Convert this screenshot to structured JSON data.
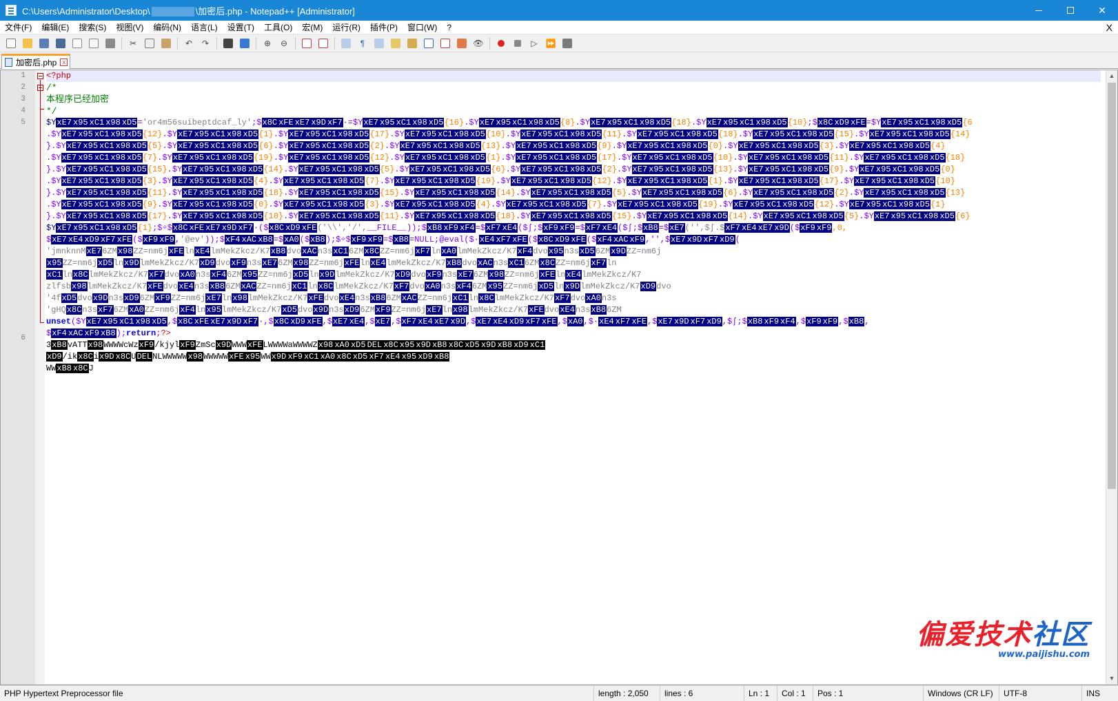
{
  "window": {
    "title_prefix": "C:\\Users\\Administrator\\Desktop\\",
    "title_suffix": "\\加密后.php - Notepad++ [Administrator]",
    "minimize": "—",
    "maximize": "☐",
    "close": "✕"
  },
  "menu": {
    "items": [
      "文件(F)",
      "编辑(E)",
      "搜索(S)",
      "视图(V)",
      "编码(N)",
      "语言(L)",
      "设置(T)",
      "工具(O)",
      "宏(M)",
      "运行(R)",
      "插件(P)",
      "窗口(W)",
      "?"
    ],
    "close_glyph": "X"
  },
  "tab": {
    "label": "加密后.php",
    "close": "x"
  },
  "editor": {
    "line_numbers": [
      "1",
      "2",
      "3",
      "4",
      "5",
      "6"
    ],
    "line1": "<?php",
    "line2": "/*",
    "line3": "本程序已经加密",
    "line4": "*/",
    "line5_start": "$Y",
    "line5_string": "'or4m56suibeptdcaf_ly'",
    "hex_tokens": [
      "xE7",
      "x95",
      "xC1",
      "x98",
      "xD5",
      "x8C",
      "xFE",
      "x9D",
      "xF7",
      "xE4",
      "xD9",
      "xA0",
      "xB8",
      "xF9",
      "xF4",
      "xAC"
    ],
    "func_file": "__FILE__",
    "at_ev": "'@ev'",
    "eval": "@eval",
    "null": "NULL",
    "unset": "unset",
    "return": "return",
    "close_tag": "?>",
    "b64_a": "'jmnknnM",
    "b64_b": "6ZM",
    "b64_c": "ZZ=nm6j",
    "b64_d": "ln",
    "b64_e": "lmMekZkcz/K7",
    "b64_f": "'4f",
    "b64_g": "dvo",
    "b64_h": "'gHQ",
    "b64_i": "zlfsb",
    "b64_j": "n3s",
    "line6_start": "3",
    "line6_a": "vATT",
    "line6_b": "WWWWcWz",
    "line6_c": "/kjyl",
    "line6_d": "ZmSc",
    "line6_e": "WWW",
    "line6_f": "LWWWWaWWWWZ",
    "line6_g": "/ik",
    "line6_h": "i",
    "line6_i": "U",
    "line6_j": "NLWWWWW",
    "line6_k": "WWWWW",
    "line6_l": "WW",
    "line6_m": "J",
    "del": "DEL"
  },
  "watermark": {
    "main_red": "偏爱技术",
    "main_blue": "社区",
    "url": "www.paijishu.com"
  },
  "status": {
    "file_type": "PHP Hypertext Preprocessor file",
    "length": "length : 2,050",
    "lines": "lines : 6",
    "ln": "Ln : 1",
    "col": "Col : 1",
    "pos": "Pos : 1",
    "eol": "Windows (CR LF)",
    "encoding": "UTF-8",
    "mode": "INS"
  }
}
